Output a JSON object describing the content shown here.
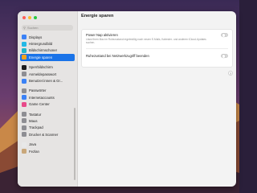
{
  "window": {
    "title": "Energie sparen",
    "traffic_lights": [
      "#ff5f57",
      "#febc2e",
      "#28c840"
    ]
  },
  "search": {
    "placeholder": "Suchen",
    "icon": "search-icon"
  },
  "sidebar": {
    "groups": [
      [
        {
          "label": "Displays",
          "icon": "display-icon",
          "color": "#3b82f6"
        },
        {
          "label": "Hintergrundbild",
          "icon": "wallpaper-icon",
          "color": "#22b8e6"
        },
        {
          "label": "Bildschirmschoner",
          "icon": "screensaver-icon",
          "color": "#1fb5c9"
        },
        {
          "label": "Energie sparen",
          "icon": "energy-saver-icon",
          "color": "#f4a21b",
          "active": true
        }
      ],
      [
        {
          "label": "Sperrbildschirm",
          "icon": "lock-screen-icon",
          "color": "#1c1c1e"
        },
        {
          "label": "Anmeldepasswort",
          "icon": "password-icon",
          "color": "#8e8e93"
        },
        {
          "label": "Benutzer:innen & Gr...",
          "icon": "users-icon",
          "color": "#3b82f6"
        }
      ],
      [
        {
          "label": "Passwörter",
          "icon": "key-icon",
          "color": "#8e8e93"
        },
        {
          "label": "Internetaccounts",
          "icon": "at-icon",
          "color": "#3b82f6"
        },
        {
          "label": "Game Center",
          "icon": "game-center-icon",
          "color": "#e84a8a"
        }
      ],
      [
        {
          "label": "Tastatur",
          "icon": "keyboard-icon",
          "color": "#8e8e93"
        },
        {
          "label": "Maus",
          "icon": "mouse-icon",
          "color": "#8e8e93"
        },
        {
          "label": "Trackpad",
          "icon": "trackpad-icon",
          "color": "#8e8e93"
        },
        {
          "label": "Drucker & Scanner",
          "icon": "printer-icon",
          "color": "#8e8e93"
        }
      ],
      [
        {
          "label": "Java",
          "icon": "java-icon",
          "color": "#e8e8e8"
        },
        {
          "label": "Fezlan",
          "icon": "fezlan-icon",
          "color": "#c9a77a"
        }
      ]
    ]
  },
  "settings": {
    "power_nap": {
      "label": "Power Nap aktivieren",
      "description": "Lässt Ihren Mac im Ruhezustand regelmäßig nach neuen E-Mails, Kalender- und anderen iCloud-Updates suchen.",
      "enabled": false
    },
    "wake_network": {
      "label": "Ruhezustand bei Netzwerkzugriff beenden",
      "enabled": false
    },
    "help_label": "?"
  }
}
